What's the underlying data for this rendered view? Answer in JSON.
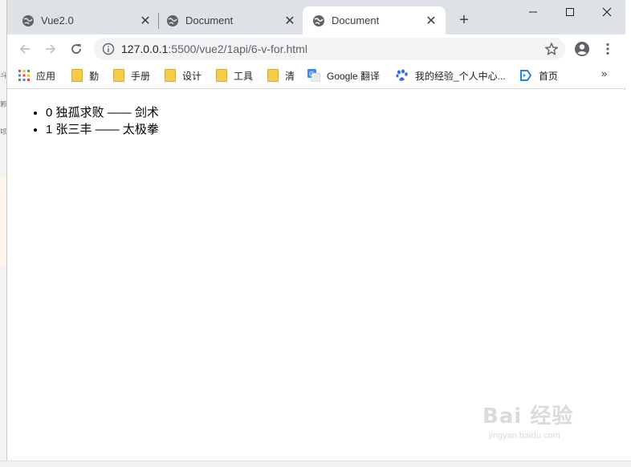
{
  "tabs": [
    {
      "title": "Vue2.0",
      "active": false
    },
    {
      "title": "Document",
      "active": false
    },
    {
      "title": "Document",
      "active": true
    }
  ],
  "window_controls": {
    "minimize": "—",
    "maximize": "☐",
    "close": "✕"
  },
  "toolbar": {
    "url_host": "127.0.0.1",
    "url_path": ":5500/vue2/1api/6-v-for.html"
  },
  "bookmarks": [
    {
      "label": "应用",
      "icon": "apps-grid-icon"
    },
    {
      "label": "勤",
      "icon": "folder-icon"
    },
    {
      "label": "手册",
      "icon": "folder-icon"
    },
    {
      "label": "设计",
      "icon": "folder-icon"
    },
    {
      "label": "工具",
      "icon": "folder-icon"
    },
    {
      "label": "清",
      "icon": "folder-icon"
    },
    {
      "label": "Google 翻译",
      "icon": "google-translate-icon"
    },
    {
      "label": "我的经验_个人中心...",
      "icon": "baidu-paw-icon"
    },
    {
      "label": "首页",
      "icon": "bilibili-icon"
    }
  ],
  "list_items": [
    "0 独孤求败 —— 剑术",
    "1 张三丰 —— 太极拳"
  ],
  "watermark": {
    "brand": "Bai 经验",
    "sub": "jingyan.baidu.com"
  },
  "colors": {
    "tabbar": "#dee1e6",
    "omnibox": "#f1f3f4",
    "folder": "#f6cd4b"
  }
}
